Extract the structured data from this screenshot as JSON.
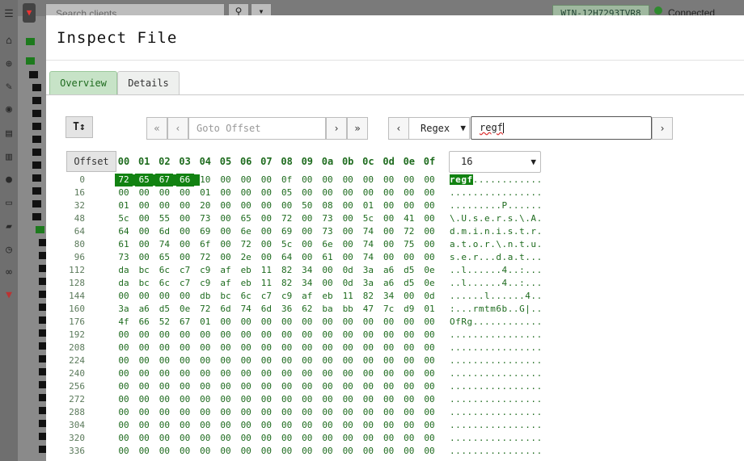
{
  "background": {
    "search_placeholder": "Search clients",
    "host": "WIN-12H7293TVR8",
    "connection_status": "Connected"
  },
  "modal": {
    "title": "Inspect File",
    "tabs": [
      {
        "label": "Overview"
      },
      {
        "label": "Details"
      }
    ]
  },
  "toolbar": {
    "sort_label": "T↕",
    "first_label": "«",
    "prev_label": "‹",
    "goto_placeholder": "Goto Offset",
    "next_label": "›",
    "last_label": "»",
    "search_prev_label": "‹",
    "search_mode": "Regex",
    "search_value": "regf",
    "search_next_label": "›"
  },
  "hexview": {
    "offset_label": "Offset",
    "columns": [
      "00",
      "01",
      "02",
      "03",
      "04",
      "05",
      "06",
      "07",
      "08",
      "09",
      "0a",
      "0b",
      "0c",
      "0d",
      "0e",
      "0f"
    ],
    "bytes_per_row": "16",
    "match_length": 4,
    "rows": [
      {
        "offset": "0",
        "hex": [
          "72",
          "65",
          "67",
          "66",
          "10",
          "00",
          "00",
          "00",
          "0f",
          "00",
          "00",
          "00",
          "00",
          "00",
          "00",
          "00"
        ],
        "ascii": "regf............"
      },
      {
        "offset": "16",
        "hex": [
          "00",
          "00",
          "00",
          "00",
          "01",
          "00",
          "00",
          "00",
          "05",
          "00",
          "00",
          "00",
          "00",
          "00",
          "00",
          "00"
        ],
        "ascii": "................"
      },
      {
        "offset": "32",
        "hex": [
          "01",
          "00",
          "00",
          "00",
          "20",
          "00",
          "00",
          "00",
          "00",
          "50",
          "08",
          "00",
          "01",
          "00",
          "00",
          "00"
        ],
        "ascii": ".........P......"
      },
      {
        "offset": "48",
        "hex": [
          "5c",
          "00",
          "55",
          "00",
          "73",
          "00",
          "65",
          "00",
          "72",
          "00",
          "73",
          "00",
          "5c",
          "00",
          "41",
          "00"
        ],
        "ascii": "\\.U.s.e.r.s.\\.A."
      },
      {
        "offset": "64",
        "hex": [
          "64",
          "00",
          "6d",
          "00",
          "69",
          "00",
          "6e",
          "00",
          "69",
          "00",
          "73",
          "00",
          "74",
          "00",
          "72",
          "00"
        ],
        "ascii": "d.m.i.n.i.s.t.r."
      },
      {
        "offset": "80",
        "hex": [
          "61",
          "00",
          "74",
          "00",
          "6f",
          "00",
          "72",
          "00",
          "5c",
          "00",
          "6e",
          "00",
          "74",
          "00",
          "75",
          "00"
        ],
        "ascii": "a.t.o.r.\\.n.t.u."
      },
      {
        "offset": "96",
        "hex": [
          "73",
          "00",
          "65",
          "00",
          "72",
          "00",
          "2e",
          "00",
          "64",
          "00",
          "61",
          "00",
          "74",
          "00",
          "00",
          "00"
        ],
        "ascii": "s.e.r...d.a.t..."
      },
      {
        "offset": "112",
        "hex": [
          "da",
          "bc",
          "6c",
          "c7",
          "c9",
          "af",
          "eb",
          "11",
          "82",
          "34",
          "00",
          "0d",
          "3a",
          "a6",
          "d5",
          "0e"
        ],
        "ascii": "..l......4..:..."
      },
      {
        "offset": "128",
        "hex": [
          "da",
          "bc",
          "6c",
          "c7",
          "c9",
          "af",
          "eb",
          "11",
          "82",
          "34",
          "00",
          "0d",
          "3a",
          "a6",
          "d5",
          "0e"
        ],
        "ascii": "..l......4..:..."
      },
      {
        "offset": "144",
        "hex": [
          "00",
          "00",
          "00",
          "00",
          "db",
          "bc",
          "6c",
          "c7",
          "c9",
          "af",
          "eb",
          "11",
          "82",
          "34",
          "00",
          "0d"
        ],
        "ascii": "......l......4.."
      },
      {
        "offset": "160",
        "hex": [
          "3a",
          "a6",
          "d5",
          "0e",
          "72",
          "6d",
          "74",
          "6d",
          "36",
          "62",
          "ba",
          "bb",
          "47",
          "7c",
          "d9",
          "01"
        ],
        "ascii": ":...rmtm6b..G|.."
      },
      {
        "offset": "176",
        "hex": [
          "4f",
          "66",
          "52",
          "67",
          "01",
          "00",
          "00",
          "00",
          "00",
          "00",
          "00",
          "00",
          "00",
          "00",
          "00",
          "00"
        ],
        "ascii": "OfRg............"
      },
      {
        "offset": "192",
        "hex": [
          "00",
          "00",
          "00",
          "00",
          "00",
          "00",
          "00",
          "00",
          "00",
          "00",
          "00",
          "00",
          "00",
          "00",
          "00",
          "00"
        ],
        "ascii": "................"
      },
      {
        "offset": "208",
        "hex": [
          "00",
          "00",
          "00",
          "00",
          "00",
          "00",
          "00",
          "00",
          "00",
          "00",
          "00",
          "00",
          "00",
          "00",
          "00",
          "00"
        ],
        "ascii": "................"
      },
      {
        "offset": "224",
        "hex": [
          "00",
          "00",
          "00",
          "00",
          "00",
          "00",
          "00",
          "00",
          "00",
          "00",
          "00",
          "00",
          "00",
          "00",
          "00",
          "00"
        ],
        "ascii": "................"
      },
      {
        "offset": "240",
        "hex": [
          "00",
          "00",
          "00",
          "00",
          "00",
          "00",
          "00",
          "00",
          "00",
          "00",
          "00",
          "00",
          "00",
          "00",
          "00",
          "00"
        ],
        "ascii": "................"
      },
      {
        "offset": "256",
        "hex": [
          "00",
          "00",
          "00",
          "00",
          "00",
          "00",
          "00",
          "00",
          "00",
          "00",
          "00",
          "00",
          "00",
          "00",
          "00",
          "00"
        ],
        "ascii": "................"
      },
      {
        "offset": "272",
        "hex": [
          "00",
          "00",
          "00",
          "00",
          "00",
          "00",
          "00",
          "00",
          "00",
          "00",
          "00",
          "00",
          "00",
          "00",
          "00",
          "00"
        ],
        "ascii": "................"
      },
      {
        "offset": "288",
        "hex": [
          "00",
          "00",
          "00",
          "00",
          "00",
          "00",
          "00",
          "00",
          "00",
          "00",
          "00",
          "00",
          "00",
          "00",
          "00",
          "00"
        ],
        "ascii": "................"
      },
      {
        "offset": "304",
        "hex": [
          "00",
          "00",
          "00",
          "00",
          "00",
          "00",
          "00",
          "00",
          "00",
          "00",
          "00",
          "00",
          "00",
          "00",
          "00",
          "00"
        ],
        "ascii": "................"
      },
      {
        "offset": "320",
        "hex": [
          "00",
          "00",
          "00",
          "00",
          "00",
          "00",
          "00",
          "00",
          "00",
          "00",
          "00",
          "00",
          "00",
          "00",
          "00",
          "00"
        ],
        "ascii": "................"
      },
      {
        "offset": "336",
        "hex": [
          "00",
          "00",
          "00",
          "00",
          "00",
          "00",
          "00",
          "00",
          "00",
          "00",
          "00",
          "00",
          "00",
          "00",
          "00",
          "00"
        ],
        "ascii": "................"
      }
    ]
  }
}
